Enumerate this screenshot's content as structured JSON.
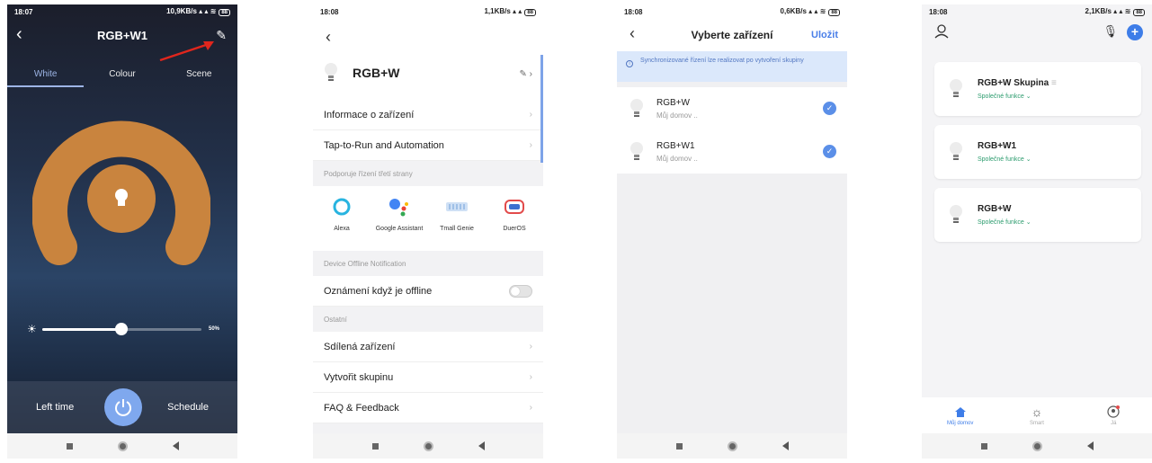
{
  "phone1": {
    "status": {
      "time": "18:07",
      "right": "10,9KB/s",
      "battery": "88"
    },
    "title": "RGB+W1",
    "tabs": [
      "White",
      "Colour",
      "Scene"
    ],
    "brightness_percent": 50,
    "brightness_label": "50%",
    "left_time": "Left time",
    "schedule": "Schedule",
    "colors": {
      "ring": "#c9843e",
      "power": "#7fa8ee",
      "arrow": "#e0261d"
    }
  },
  "phone2": {
    "status": {
      "time": "18:08",
      "right": "1,1KB/s",
      "battery": "88"
    },
    "device_name": "RGB+W",
    "rows_top": [
      "Informace o zařízení",
      "Tap-to-Run and Automation"
    ],
    "section_third_party": "Podporuje řízení třetí strany",
    "assistants": [
      {
        "label": "Alexa"
      },
      {
        "label": "Google Assistant"
      },
      {
        "label": "Tmall Genie"
      },
      {
        "label": "DuerOS"
      }
    ],
    "section_offline": "Device Offline Notification",
    "offline_row": "Oznámení když je offline",
    "section_other": "Ostatní",
    "rows_other": [
      "Sdílená zařízení",
      "Vytvořit skupinu",
      "FAQ & Feedback"
    ]
  },
  "phone3": {
    "status": {
      "time": "18:08",
      "right": "0,6KB/s",
      "battery": "88"
    },
    "title": "Vyberte zařízení",
    "save": "Uložit",
    "banner": "Synchronizované řízení lze realizovat po vytvoření skupiny",
    "devices": [
      {
        "name": "RGB+W",
        "home": "Můj domov .."
      },
      {
        "name": "RGB+W1",
        "home": "Můj domov .."
      }
    ]
  },
  "phone4": {
    "status": {
      "time": "18:08",
      "right": "2,1KB/s",
      "battery": "88"
    },
    "cards": [
      {
        "name": "RGB+W Skupina",
        "sub": "Společné funkce"
      },
      {
        "name": "RGB+W1",
        "sub": "Společné funkce"
      },
      {
        "name": "RGB+W",
        "sub": "Společné funkce"
      }
    ],
    "tabs": [
      "Můj domov",
      "Smart",
      "Já"
    ]
  }
}
